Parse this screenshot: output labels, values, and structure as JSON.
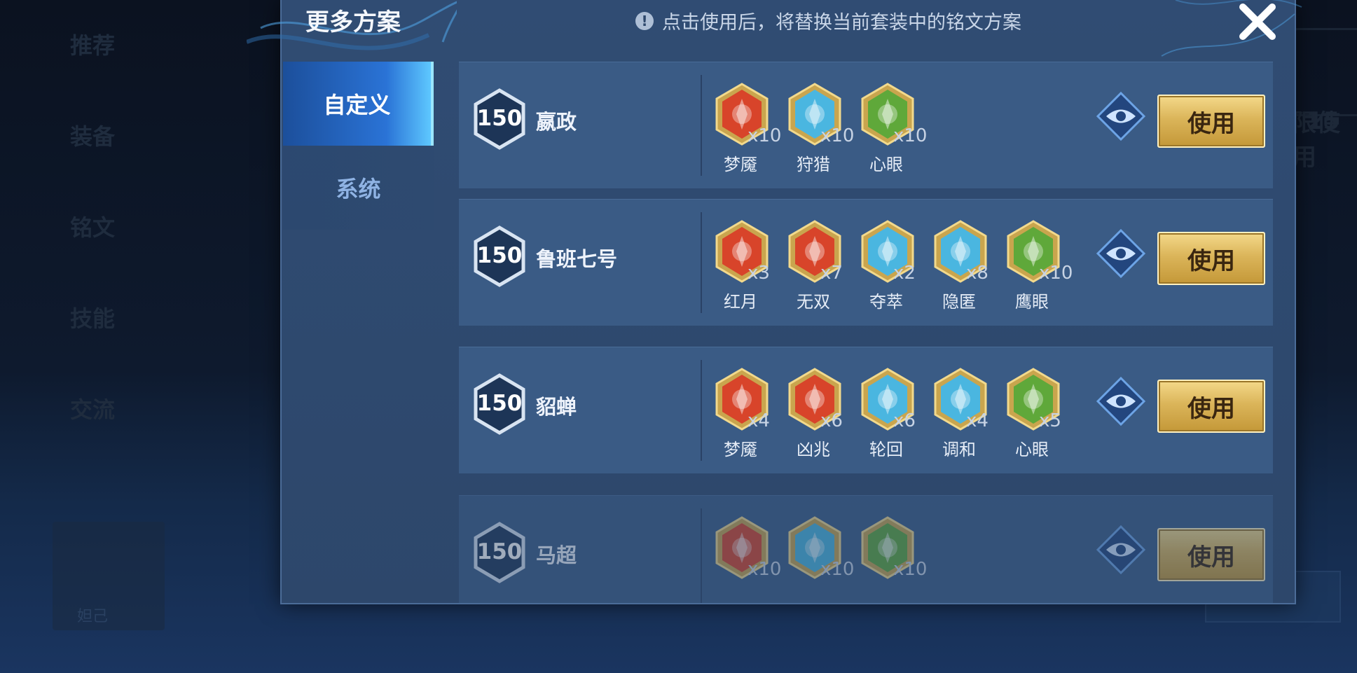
{
  "background": {
    "nav": [
      "推荐",
      "装备",
      "铭文",
      "技能",
      "交流"
    ],
    "hero_card": "妲己",
    "right_level": "15",
    "right_text": "限使用"
  },
  "modal": {
    "title": "更多方案",
    "notice": "点击使用后，将替换当前套装中的铭文方案",
    "tabs": [
      {
        "label": "自定义",
        "active": true
      },
      {
        "label": "系统",
        "active": false
      }
    ],
    "use_label": "使用",
    "plans": [
      {
        "level": "150",
        "hero": "嬴政",
        "runes": [
          {
            "name": "梦魇",
            "count": "x10",
            "color": "#d8442a"
          },
          {
            "name": "狩猎",
            "count": "x10",
            "color": "#4ab6e0"
          },
          {
            "name": "心眼",
            "count": "x10",
            "color": "#5fa83a"
          }
        ]
      },
      {
        "level": "150",
        "hero": "鲁班七号",
        "runes": [
          {
            "name": "红月",
            "count": "x3",
            "color": "#d8442a"
          },
          {
            "name": "无双",
            "count": "x7",
            "color": "#d8442a"
          },
          {
            "name": "夺萃",
            "count": "x2",
            "color": "#4ab6e0"
          },
          {
            "name": "隐匿",
            "count": "x8",
            "color": "#4ab6e0"
          },
          {
            "name": "鹰眼",
            "count": "x10",
            "color": "#5fa83a"
          }
        ]
      },
      {
        "level": "150",
        "hero": "貂蝉",
        "runes": [
          {
            "name": "梦魇",
            "count": "x4",
            "color": "#d8442a"
          },
          {
            "name": "凶兆",
            "count": "x6",
            "color": "#d8442a"
          },
          {
            "name": "轮回",
            "count": "x6",
            "color": "#4ab6e0"
          },
          {
            "name": "调和",
            "count": "x4",
            "color": "#4ab6e0"
          },
          {
            "name": "心眼",
            "count": "x5",
            "color": "#5fa83a"
          }
        ]
      },
      {
        "level": "150",
        "hero": "马超",
        "runes": [
          {
            "name": "",
            "count": "x10",
            "color": "#d8442a"
          },
          {
            "name": "",
            "count": "x10",
            "color": "#4ab6e0"
          },
          {
            "name": "",
            "count": "x10",
            "color": "#5fa83a"
          }
        ]
      }
    ]
  }
}
